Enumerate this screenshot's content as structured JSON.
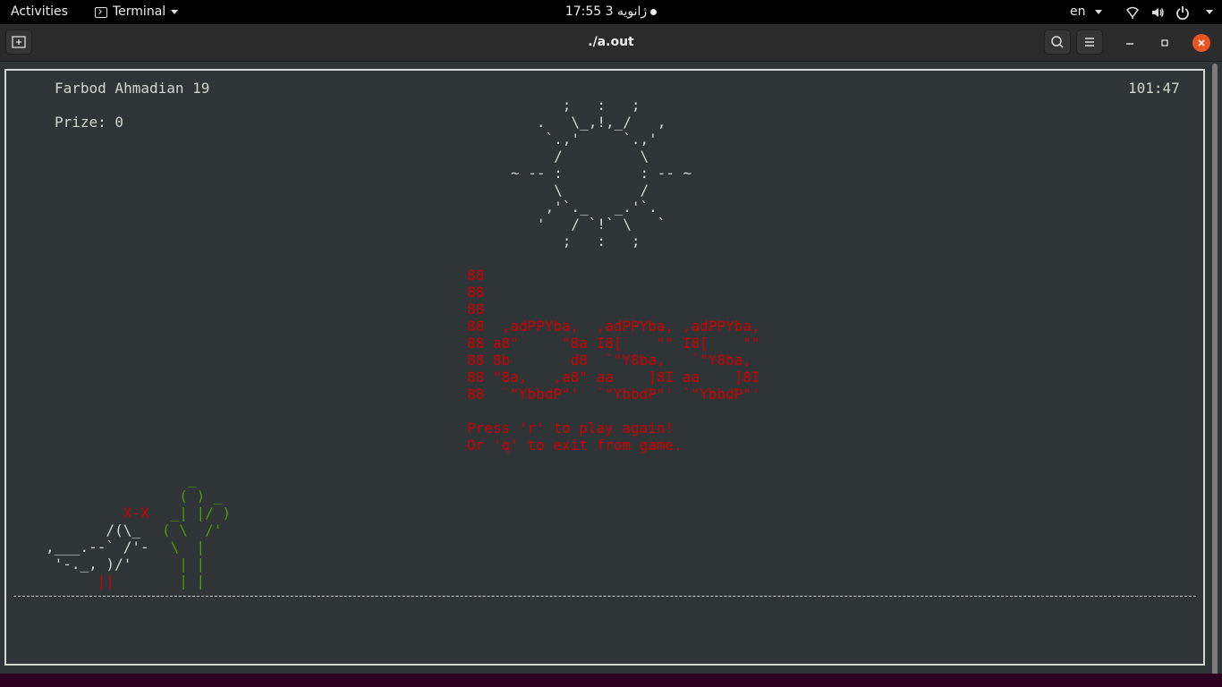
{
  "topbar": {
    "activities": "Activities",
    "app_name": "Terminal",
    "clock": "17:55 ژانویه 3",
    "language": "en"
  },
  "window": {
    "title": "./a.out"
  },
  "game": {
    "player": "Farbod Ahmadian 19",
    "prize": "Prize: 0",
    "timer": "101:47",
    "sun": [
      "      ;   :   ;",
      "   .   \\_,!,_/   ,",
      "    `.,'     `.,'",
      "     /         \\",
      "~ -- :         : -- ~",
      "     \\         /",
      "    ,'`._   _.'`.",
      "   '   / `!` \\   `",
      "      ;   :   ;"
    ],
    "logo": [
      "88",
      "88",
      "88",
      "88  ,adPPYba,  ,adPPYba, ,adPPYba,",
      "88 a8\"     \"8a I8[    \"\" I8[    \"\"",
      "88 8b       d8  `\"Y8ba,   `\"Y8ba,",
      "88 \"8a,   ,a8\" aa    ]8I aa    ]8I",
      "88  `\"YbbdP\"'  `\"YbbdP\"' `\"YbbdP\"'"
    ],
    "message": [
      "Press 'r' to play again!",
      "Or 'q' to exit from game."
    ],
    "dino": [
      "",
      "",
      "         X-X",
      "       /(\\_",
      ",___.--` /'-",
      " '-._, )/'",
      "      ||"
    ],
    "cactus": [
      "   _",
      "  ( ) _",
      " _| |/ )",
      "( \\  /'",
      " \\  |",
      "  | |",
      "  | |"
    ]
  }
}
